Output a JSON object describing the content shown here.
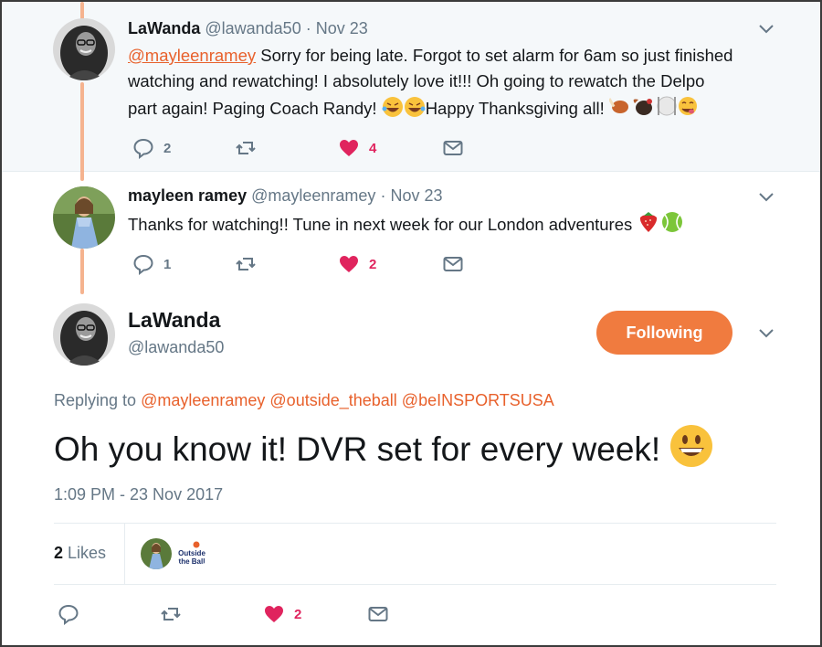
{
  "reply1": {
    "name": "LaWanda",
    "handle": "@lawanda50",
    "date": "· Nov 23",
    "mention": "@mayleenramey",
    "text_line1": " Sorry for being late. Forgot to set alarm for 6am so just finished",
    "text_line2": "watching and rewatching! I absolutely love it!!! Oh going to rewatch the Delpo",
    "text_line3": "part again! Paging Coach Randy! ",
    "text_line3b": "Happy Thanksgiving all! ",
    "reply_count": "2",
    "like_count": "4"
  },
  "reply2": {
    "name": "mayleen ramey",
    "handle": "@mayleenramey",
    "date": "· Nov 23",
    "text": "Thanks for watching!! Tune in next week for our London adventures ",
    "reply_count": "1",
    "like_count": "2"
  },
  "main_tweet": {
    "name": "LaWanda",
    "handle": "@lawanda50",
    "follow_label": "Following",
    "replying_prefix": "Replying to ",
    "replying_mentions": [
      "@mayleenramey",
      "@outside_theball",
      "@beINSPORTSUSA"
    ],
    "text": "Oh you know it! DVR set for every week! ",
    "timestamp": "1:09 PM - 23 Nov 2017",
    "likes_number": "2",
    "likes_label": " Likes",
    "like_count": "2",
    "mini_logo_text_1": "Outside",
    "mini_logo_text_2": "the Ball"
  },
  "colors": {
    "accent": "#f07b3f",
    "like": "#e0245e",
    "muted": "#657786",
    "mention": "#e8612c",
    "thread_line": "#f5b38f"
  },
  "icons": [
    "reply-icon",
    "retweet-icon",
    "heart-icon",
    "message-icon",
    "chevron-down-icon"
  ]
}
